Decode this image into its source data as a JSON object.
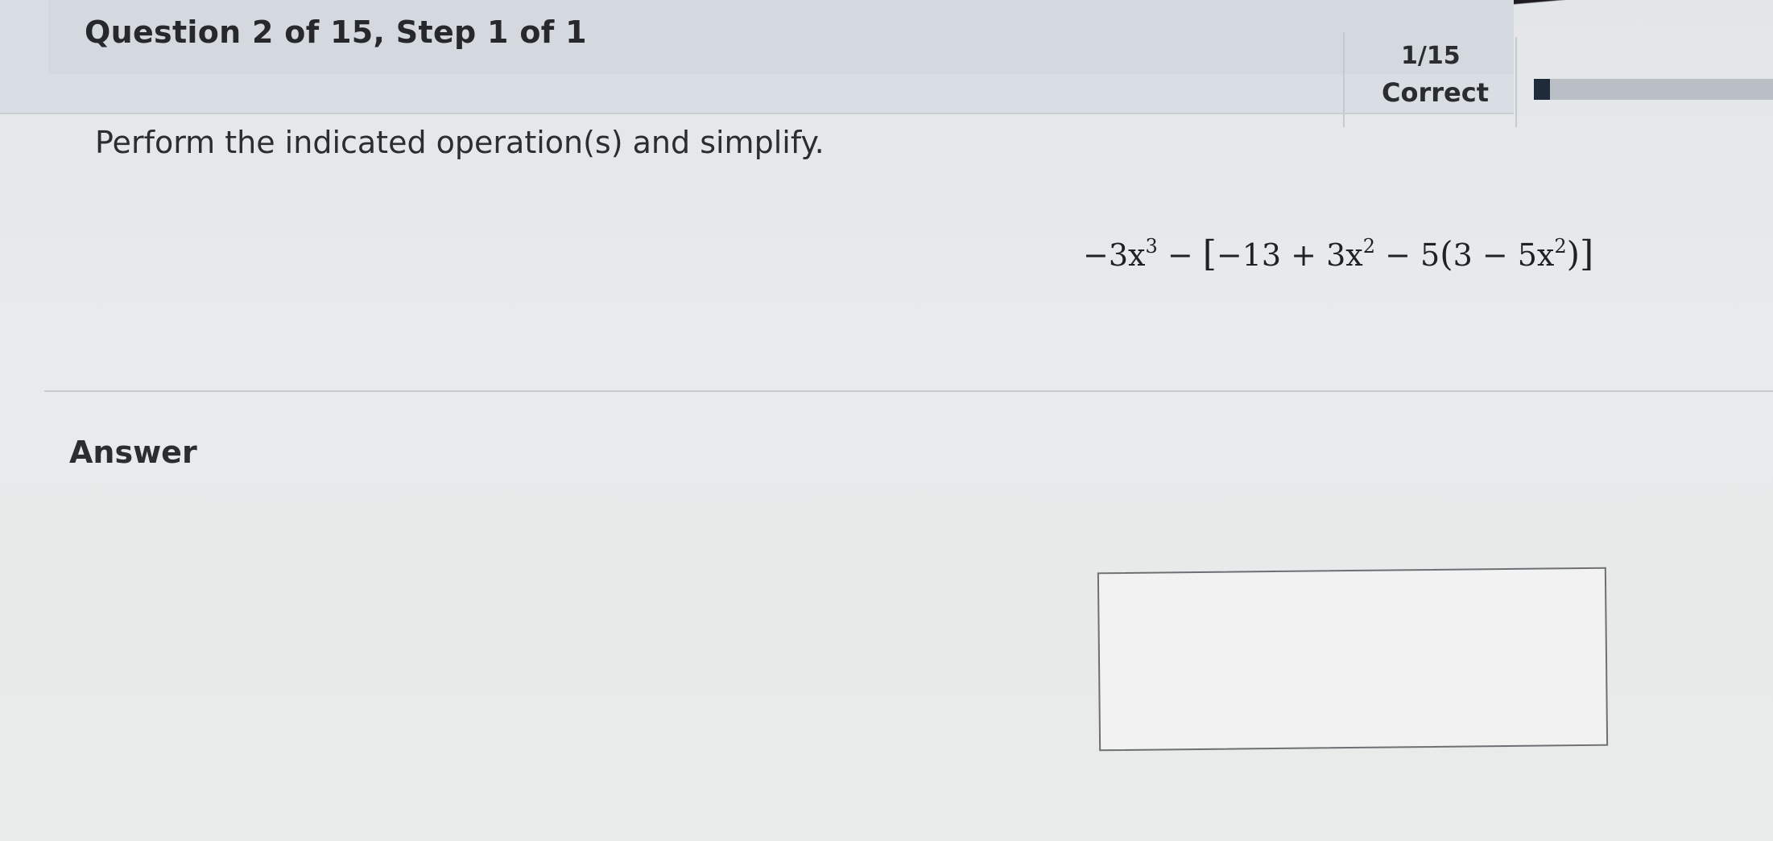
{
  "header": {
    "question_title": "Question 2 of 15,  Step 1 of 1",
    "progress_count": "1/15",
    "progress_status": "Correct",
    "progress_fraction": 0.0667
  },
  "question": {
    "instruction": "Perform the indicated operation(s) and simplify.",
    "expression": {
      "part1": "−3x",
      "exp1": "3",
      "part2": " − ",
      "open_bracket": "[",
      "part3": "−13 + 3x",
      "exp2": "2",
      "part4": " − 5",
      "open_paren": "(",
      "part5": "3 − 5x",
      "exp3": "2",
      "close_paren": ")",
      "close_bracket": "]"
    }
  },
  "answer": {
    "label": "Answer",
    "value": ""
  },
  "colors": {
    "header_bg": "#d3d9df",
    "progress_fill": "#1f2b3a",
    "progress_track": "#b9bfc4"
  }
}
